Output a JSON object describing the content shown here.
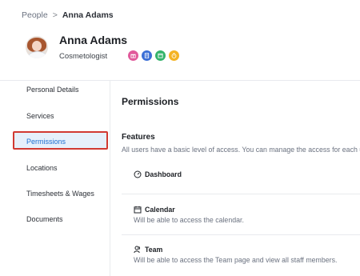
{
  "breadcrumb": {
    "parent": "People",
    "separator": ">",
    "current": "Anna Adams"
  },
  "profile": {
    "name": "Anna Adams",
    "role": "Cosmetologist"
  },
  "service_icons": [
    {
      "icon": "gift-icon",
      "color": "#e15a9b"
    },
    {
      "icon": "document-icon",
      "color": "#3b6fd6"
    },
    {
      "icon": "calendar-icon",
      "color": "#34b36b"
    },
    {
      "icon": "timer-icon",
      "color": "#f4b324"
    }
  ],
  "sidebar": {
    "items": [
      {
        "label": "Personal Details"
      },
      {
        "label": "Services"
      },
      {
        "label": "Permissions",
        "active": true
      },
      {
        "label": "Locations"
      },
      {
        "label": "Timesheets & Wages"
      },
      {
        "label": "Documents"
      }
    ]
  },
  "main": {
    "title": "Permissions",
    "features_title": "Features",
    "features_desc": "All users have a basic level of access. You can manage the access for each user",
    "features": [
      {
        "icon": "dashboard-icon",
        "title": "Dashboard",
        "desc": ""
      },
      {
        "icon": "calendar-icon",
        "title": "Calendar",
        "desc": "Will be able to access the calendar."
      },
      {
        "icon": "team-icon",
        "title": "Team",
        "desc": "Will be able to access the Team page and view all staff members."
      }
    ]
  },
  "colors": {
    "active_text": "#1d6fd1",
    "active_bg": "#e6f0fb",
    "highlight_border": "#d13a32"
  }
}
